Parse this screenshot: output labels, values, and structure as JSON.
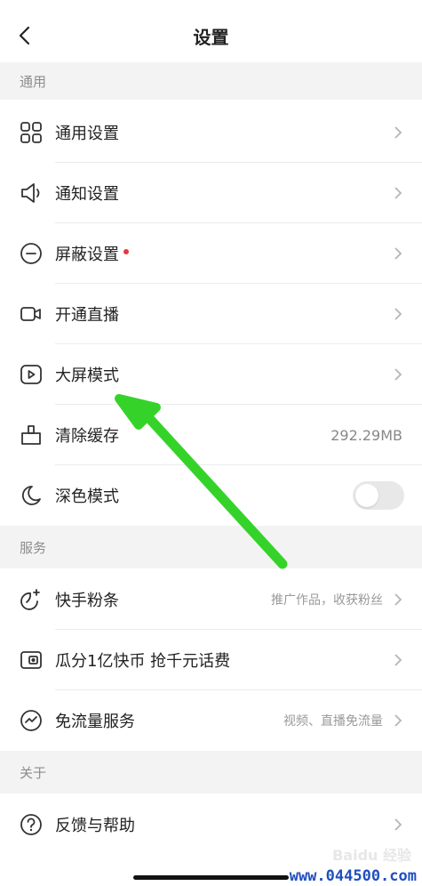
{
  "header": {
    "title": "设置"
  },
  "sections": {
    "general": "通用",
    "services": "服务",
    "about": "关于"
  },
  "general_items": [
    {
      "label": "通用设置",
      "icon": "grid-icon"
    },
    {
      "label": "通知设置",
      "icon": "speaker-icon"
    },
    {
      "label": "屏蔽设置",
      "icon": "block-icon",
      "badge": "red-dot"
    },
    {
      "label": "开通直播",
      "icon": "video-camera-icon"
    },
    {
      "label": "大屏模式",
      "icon": "play-screen-icon"
    },
    {
      "label": "清除缓存",
      "icon": "broom-icon",
      "value": "292.29MB"
    },
    {
      "label": "深色模式",
      "icon": "moon-icon",
      "toggle": false
    }
  ],
  "service_items": [
    {
      "label": "快手粉条",
      "icon": "sparkle-icon",
      "sub": "推广作品，收获粉丝"
    },
    {
      "label": "瓜分1亿快币 抢千元话费",
      "icon": "wallet-icon"
    },
    {
      "label": "免流量服务",
      "icon": "trend-icon",
      "sub": "视频、直播免流量"
    }
  ],
  "about_items": [
    {
      "label": "反馈与帮助",
      "icon": "help-icon"
    }
  ],
  "watermark": {
    "logo": "Baidu 经验",
    "url": "www.044500.com"
  },
  "colors": {
    "arrow": "#35d32a",
    "badge": "#e6393e",
    "section_bg": "#f3f3f3"
  }
}
